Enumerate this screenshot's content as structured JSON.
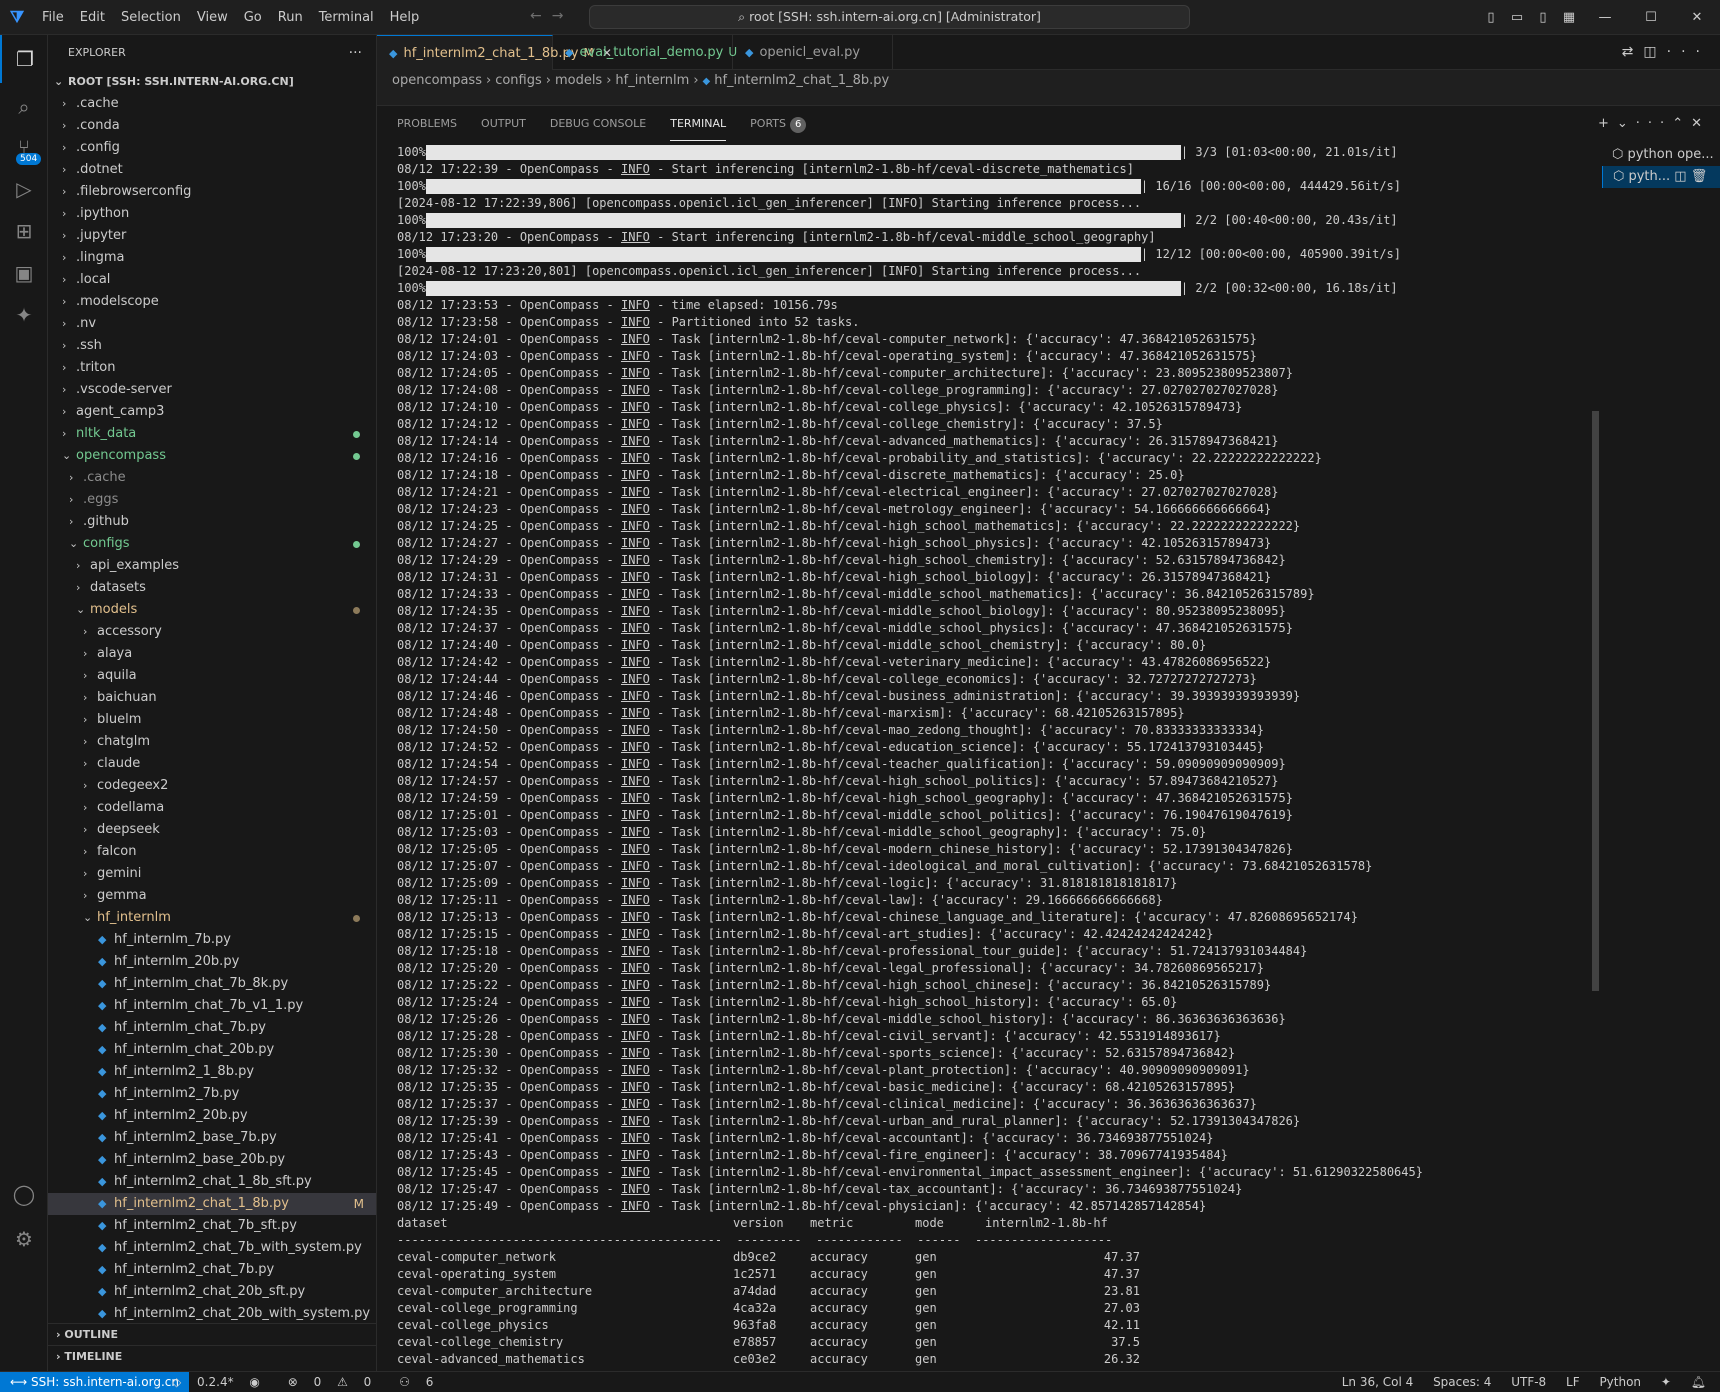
{
  "menu": [
    "File",
    "Edit",
    "Selection",
    "View",
    "Go",
    "Run",
    "Terminal",
    "Help"
  ],
  "command_center": "root [SSH: ssh.intern-ai.org.cn] [Administrator]",
  "activity_badge": "504",
  "explorer": {
    "title": "EXPLORER",
    "root": "ROOT [SSH: SSH.INTERN-AI.ORG.CN]",
    "items": [
      {
        "label": ".cache",
        "depth": 0,
        "type": "folder",
        "open": false
      },
      {
        "label": ".conda",
        "depth": 0,
        "type": "folder",
        "open": false
      },
      {
        "label": ".config",
        "depth": 0,
        "type": "folder",
        "open": false
      },
      {
        "label": ".dotnet",
        "depth": 0,
        "type": "folder",
        "open": false
      },
      {
        "label": ".filebrowserconfig",
        "depth": 0,
        "type": "folder",
        "open": false
      },
      {
        "label": ".ipython",
        "depth": 0,
        "type": "folder",
        "open": false
      },
      {
        "label": ".jupyter",
        "depth": 0,
        "type": "folder",
        "open": false
      },
      {
        "label": ".lingma",
        "depth": 0,
        "type": "folder",
        "open": false
      },
      {
        "label": ".local",
        "depth": 0,
        "type": "folder",
        "open": false
      },
      {
        "label": ".modelscope",
        "depth": 0,
        "type": "folder",
        "open": false
      },
      {
        "label": ".nv",
        "depth": 0,
        "type": "folder",
        "open": false
      },
      {
        "label": ".ssh",
        "depth": 0,
        "type": "folder",
        "open": false
      },
      {
        "label": ".triton",
        "depth": 0,
        "type": "folder",
        "open": false
      },
      {
        "label": ".vscode-server",
        "depth": 0,
        "type": "folder",
        "open": false
      },
      {
        "label": "agent_camp3",
        "depth": 0,
        "type": "folder",
        "open": false
      },
      {
        "label": "nltk_data",
        "depth": 0,
        "type": "folder",
        "open": false,
        "color": "#73c991",
        "dot": "#73c991"
      },
      {
        "label": "opencompass",
        "depth": 0,
        "type": "folder",
        "open": true,
        "color": "#73c991",
        "dot": "#73c991"
      },
      {
        "label": ".cache",
        "depth": 1,
        "type": "folder",
        "open": false,
        "color": "#8c8c8c"
      },
      {
        "label": ".eggs",
        "depth": 1,
        "type": "folder",
        "open": false,
        "color": "#8c8c8c"
      },
      {
        "label": ".github",
        "depth": 1,
        "type": "folder",
        "open": false
      },
      {
        "label": "configs",
        "depth": 1,
        "type": "folder",
        "open": true,
        "color": "#73c991",
        "dot": "#73c991"
      },
      {
        "label": "api_examples",
        "depth": 2,
        "type": "folder",
        "open": false
      },
      {
        "label": "datasets",
        "depth": 2,
        "type": "folder",
        "open": false
      },
      {
        "label": "models",
        "depth": 2,
        "type": "folder",
        "open": true,
        "color": "#e2c08d",
        "dot": "#8c7a5a"
      },
      {
        "label": "accessory",
        "depth": 3,
        "type": "folder",
        "open": false
      },
      {
        "label": "alaya",
        "depth": 3,
        "type": "folder",
        "open": false
      },
      {
        "label": "aquila",
        "depth": 3,
        "type": "folder",
        "open": false
      },
      {
        "label": "baichuan",
        "depth": 3,
        "type": "folder",
        "open": false
      },
      {
        "label": "bluelm",
        "depth": 3,
        "type": "folder",
        "open": false
      },
      {
        "label": "chatglm",
        "depth": 3,
        "type": "folder",
        "open": false
      },
      {
        "label": "claude",
        "depth": 3,
        "type": "folder",
        "open": false
      },
      {
        "label": "codegeex2",
        "depth": 3,
        "type": "folder",
        "open": false
      },
      {
        "label": "codellama",
        "depth": 3,
        "type": "folder",
        "open": false
      },
      {
        "label": "deepseek",
        "depth": 3,
        "type": "folder",
        "open": false
      },
      {
        "label": "falcon",
        "depth": 3,
        "type": "folder",
        "open": false
      },
      {
        "label": "gemini",
        "depth": 3,
        "type": "folder",
        "open": false
      },
      {
        "label": "gemma",
        "depth": 3,
        "type": "folder",
        "open": false
      },
      {
        "label": "hf_internlm",
        "depth": 3,
        "type": "folder",
        "open": true,
        "color": "#e2c08d",
        "dot": "#8c7a5a"
      },
      {
        "label": "hf_internlm_7b.py",
        "depth": 4,
        "type": "file"
      },
      {
        "label": "hf_internlm_20b.py",
        "depth": 4,
        "type": "file"
      },
      {
        "label": "hf_internlm_chat_7b_8k.py",
        "depth": 4,
        "type": "file"
      },
      {
        "label": "hf_internlm_chat_7b_v1_1.py",
        "depth": 4,
        "type": "file"
      },
      {
        "label": "hf_internlm_chat_7b.py",
        "depth": 4,
        "type": "file"
      },
      {
        "label": "hf_internlm_chat_20b.py",
        "depth": 4,
        "type": "file"
      },
      {
        "label": "hf_internlm2_1_8b.py",
        "depth": 4,
        "type": "file"
      },
      {
        "label": "hf_internlm2_7b.py",
        "depth": 4,
        "type": "file"
      },
      {
        "label": "hf_internlm2_20b.py",
        "depth": 4,
        "type": "file"
      },
      {
        "label": "hf_internlm2_base_7b.py",
        "depth": 4,
        "type": "file"
      },
      {
        "label": "hf_internlm2_base_20b.py",
        "depth": 4,
        "type": "file"
      },
      {
        "label": "hf_internlm2_chat_1_8b_sft.py",
        "depth": 4,
        "type": "file"
      },
      {
        "label": "hf_internlm2_chat_1_8b.py",
        "depth": 4,
        "type": "file",
        "selected": true,
        "color": "#e2c08d",
        "mark": "M"
      },
      {
        "label": "hf_internlm2_chat_7b_sft.py",
        "depth": 4,
        "type": "file"
      },
      {
        "label": "hf_internlm2_chat_7b_with_system.py",
        "depth": 4,
        "type": "file"
      },
      {
        "label": "hf_internlm2_chat_7b.py",
        "depth": 4,
        "type": "file"
      },
      {
        "label": "hf_internlm2_chat_20b_sft.py",
        "depth": 4,
        "type": "file"
      },
      {
        "label": "hf_internlm2_chat_20b_with_system.py",
        "depth": 4,
        "type": "file"
      }
    ],
    "outline": "OUTLINE",
    "timeline": "TIMELINE"
  },
  "tabs": [
    {
      "label": "hf_internlm2_chat_1_8b.py",
      "mark": "M",
      "active": true,
      "color": "#e2c08d"
    },
    {
      "label": "eval_tutorial_demo.py",
      "mark": "U",
      "active": false,
      "color": "#73c991"
    },
    {
      "label": "openicl_eval.py",
      "mark": "",
      "active": false,
      "color": "#9d9d9d"
    }
  ],
  "breadcrumbs": [
    "opencompass",
    "configs",
    "models",
    "hf_internlm",
    "hf_internlm2_chat_1_8b.py"
  ],
  "panel_tabs": [
    "PROBLEMS",
    "OUTPUT",
    "DEBUG CONSOLE",
    "TERMINAL",
    "PORTS"
  ],
  "ports_count": "6",
  "terminal_list": [
    "python ope...",
    "pyth..."
  ],
  "terminal": {
    "progress": [
      {
        "pct": "100%",
        "rest": "| 3/3 [01:03<00:00, 21.01s/it]"
      },
      {
        "pct": "100%",
        "rest": "| 16/16 [00:00<00:00, 444429.56it/s]"
      },
      {
        "pct": "100%",
        "rest": "| 2/2 [00:40<00:00, 20.43s/it]"
      },
      {
        "pct": "100%",
        "rest": "| 12/12 [00:00<00:00, 405900.39it/s]"
      },
      {
        "pct": "100%",
        "rest": "| 2/2 [00:32<00:00, 16.18s/it]"
      }
    ],
    "info": [
      {
        "time": "08/12 17:22:39",
        "msg": "Start inferencing [internlm2-1.8b-hf/ceval-discrete_mathematics]"
      },
      {
        "time": "08/12 17:23:20",
        "msg": "Start inferencing [internlm2-1.8b-hf/ceval-middle_school_geography]"
      }
    ],
    "raw": [
      "[2024-08-12 17:22:39,806] [opencompass.openicl.icl_gen_inferencer] [INFO] Starting inference process...",
      "[2024-08-12 17:23:20,801] [opencompass.openicl.icl_gen_inferencer] [INFO] Starting inference process..."
    ],
    "summary": [
      {
        "time": "08/12 17:23:53",
        "msg": "time elapsed: 10156.79s"
      },
      {
        "time": "08/12 17:23:58",
        "msg": "Partitioned into 52 tasks."
      }
    ],
    "tasks": [
      {
        "time": "08/12 17:24:01",
        "task": "ceval-computer_network",
        "acc": "47.368421052631575"
      },
      {
        "time": "08/12 17:24:03",
        "task": "ceval-operating_system",
        "acc": "47.368421052631575"
      },
      {
        "time": "08/12 17:24:05",
        "task": "ceval-computer_architecture",
        "acc": "23.809523809523807"
      },
      {
        "time": "08/12 17:24:08",
        "task": "ceval-college_programming",
        "acc": "27.027027027027028"
      },
      {
        "time": "08/12 17:24:10",
        "task": "ceval-college_physics",
        "acc": "42.10526315789473"
      },
      {
        "time": "08/12 17:24:12",
        "task": "ceval-college_chemistry",
        "acc": "37.5"
      },
      {
        "time": "08/12 17:24:14",
        "task": "ceval-advanced_mathematics",
        "acc": "26.31578947368421"
      },
      {
        "time": "08/12 17:24:16",
        "task": "ceval-probability_and_statistics",
        "acc": "22.22222222222222"
      },
      {
        "time": "08/12 17:24:18",
        "task": "ceval-discrete_mathematics",
        "acc": "25.0"
      },
      {
        "time": "08/12 17:24:21",
        "task": "ceval-electrical_engineer",
        "acc": "27.027027027027028"
      },
      {
        "time": "08/12 17:24:23",
        "task": "ceval-metrology_engineer",
        "acc": "54.166666666666664"
      },
      {
        "time": "08/12 17:24:25",
        "task": "ceval-high_school_mathematics",
        "acc": "22.22222222222222"
      },
      {
        "time": "08/12 17:24:27",
        "task": "ceval-high_school_physics",
        "acc": "42.10526315789473"
      },
      {
        "time": "08/12 17:24:29",
        "task": "ceval-high_school_chemistry",
        "acc": "52.63157894736842"
      },
      {
        "time": "08/12 17:24:31",
        "task": "ceval-high_school_biology",
        "acc": "26.31578947368421"
      },
      {
        "time": "08/12 17:24:33",
        "task": "ceval-middle_school_mathematics",
        "acc": "36.84210526315789"
      },
      {
        "time": "08/12 17:24:35",
        "task": "ceval-middle_school_biology",
        "acc": "80.95238095238095"
      },
      {
        "time": "08/12 17:24:37",
        "task": "ceval-middle_school_physics",
        "acc": "47.368421052631575"
      },
      {
        "time": "08/12 17:24:40",
        "task": "ceval-middle_school_chemistry",
        "acc": "80.0"
      },
      {
        "time": "08/12 17:24:42",
        "task": "ceval-veterinary_medicine",
        "acc": "43.47826086956522"
      },
      {
        "time": "08/12 17:24:44",
        "task": "ceval-college_economics",
        "acc": "32.72727272727273"
      },
      {
        "time": "08/12 17:24:46",
        "task": "ceval-business_administration",
        "acc": "39.39393939393939"
      },
      {
        "time": "08/12 17:24:48",
        "task": "ceval-marxism",
        "acc": "68.42105263157895"
      },
      {
        "time": "08/12 17:24:50",
        "task": "ceval-mao_zedong_thought",
        "acc": "70.83333333333334"
      },
      {
        "time": "08/12 17:24:52",
        "task": "ceval-education_science",
        "acc": "55.172413793103445"
      },
      {
        "time": "08/12 17:24:54",
        "task": "ceval-teacher_qualification",
        "acc": "59.09090909090909"
      },
      {
        "time": "08/12 17:24:57",
        "task": "ceval-high_school_politics",
        "acc": "57.89473684210527"
      },
      {
        "time": "08/12 17:24:59",
        "task": "ceval-high_school_geography",
        "acc": "47.368421052631575"
      },
      {
        "time": "08/12 17:25:01",
        "task": "ceval-middle_school_politics",
        "acc": "76.19047619047619"
      },
      {
        "time": "08/12 17:25:03",
        "task": "ceval-middle_school_geography",
        "acc": "75.0"
      },
      {
        "time": "08/12 17:25:05",
        "task": "ceval-modern_chinese_history",
        "acc": "52.17391304347826"
      },
      {
        "time": "08/12 17:25:07",
        "task": "ceval-ideological_and_moral_cultivation",
        "acc": "73.68421052631578"
      },
      {
        "time": "08/12 17:25:09",
        "task": "ceval-logic",
        "acc": "31.818181818181817"
      },
      {
        "time": "08/12 17:25:11",
        "task": "ceval-law",
        "acc": "29.166666666666668"
      },
      {
        "time": "08/12 17:25:13",
        "task": "ceval-chinese_language_and_literature",
        "acc": "47.82608695652174"
      },
      {
        "time": "08/12 17:25:15",
        "task": "ceval-art_studies",
        "acc": "42.42424242424242"
      },
      {
        "time": "08/12 17:25:18",
        "task": "ceval-professional_tour_guide",
        "acc": "51.724137931034484"
      },
      {
        "time": "08/12 17:25:20",
        "task": "ceval-legal_professional",
        "acc": "34.78260869565217"
      },
      {
        "time": "08/12 17:25:22",
        "task": "ceval-high_school_chinese",
        "acc": "36.84210526315789"
      },
      {
        "time": "08/12 17:25:24",
        "task": "ceval-high_school_history",
        "acc": "65.0"
      },
      {
        "time": "08/12 17:25:26",
        "task": "ceval-middle_school_history",
        "acc": "86.36363636363636"
      },
      {
        "time": "08/12 17:25:28",
        "task": "ceval-civil_servant",
        "acc": "42.5531914893617"
      },
      {
        "time": "08/12 17:25:30",
        "task": "ceval-sports_science",
        "acc": "52.63157894736842"
      },
      {
        "time": "08/12 17:25:32",
        "task": "ceval-plant_protection",
        "acc": "40.90909090909091"
      },
      {
        "time": "08/12 17:25:35",
        "task": "ceval-basic_medicine",
        "acc": "68.42105263157895"
      },
      {
        "time": "08/12 17:25:37",
        "task": "ceval-clinical_medicine",
        "acc": "36.36363636363637"
      },
      {
        "time": "08/12 17:25:39",
        "task": "ceval-urban_and_rural_planner",
        "acc": "52.17391304347826"
      },
      {
        "time": "08/12 17:25:41",
        "task": "ceval-accountant",
        "acc": "36.734693877551024"
      },
      {
        "time": "08/12 17:25:43",
        "task": "ceval-fire_engineer",
        "acc": "38.70967741935484"
      },
      {
        "time": "08/12 17:25:45",
        "task": "ceval-environmental_impact_assessment_engineer",
        "acc": "51.61290322580645"
      },
      {
        "time": "08/12 17:25:47",
        "task": "ceval-tax_accountant",
        "acc": "36.734693877551024"
      },
      {
        "time": "08/12 17:25:49",
        "task": "ceval-physician",
        "acc": "42.857142857142854"
      }
    ],
    "table_header": {
      "dataset": "dataset",
      "version": "version",
      "metric": "metric",
      "mode": "mode",
      "model": "internlm2-1.8b-hf"
    },
    "table_rows": [
      {
        "dataset": "ceval-computer_network",
        "version": "db9ce2",
        "metric": "accuracy",
        "mode": "gen",
        "value": "47.37"
      },
      {
        "dataset": "ceval-operating_system",
        "version": "1c2571",
        "metric": "accuracy",
        "mode": "gen",
        "value": "47.37"
      },
      {
        "dataset": "ceval-computer_architecture",
        "version": "a74dad",
        "metric": "accuracy",
        "mode": "gen",
        "value": "23.81"
      },
      {
        "dataset": "ceval-college_programming",
        "version": "4ca32a",
        "metric": "accuracy",
        "mode": "gen",
        "value": "27.03"
      },
      {
        "dataset": "ceval-college_physics",
        "version": "963fa8",
        "metric": "accuracy",
        "mode": "gen",
        "value": "42.11"
      },
      {
        "dataset": "ceval-college_chemistry",
        "version": "e78857",
        "metric": "accuracy",
        "mode": "gen",
        "value": "37.5"
      },
      {
        "dataset": "ceval-advanced_mathematics",
        "version": "ce03e2",
        "metric": "accuracy",
        "mode": "gen",
        "value": "26.32"
      }
    ]
  },
  "status": {
    "remote": "SSH: ssh.intern-ai.org.cn",
    "version": "0.2.4*",
    "errors": "0",
    "warnings": "0",
    "ports": "6",
    "position": "Ln 36, Col 4",
    "spaces": "Spaces: 4",
    "encoding": "UTF-8",
    "eol": "LF",
    "language": "Python"
  }
}
